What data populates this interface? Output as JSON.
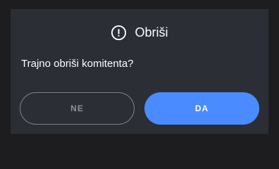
{
  "dialog": {
    "title": "Obriši",
    "title_icon": "exclamation-circle-icon",
    "message": "Trajno obriši komitenta?",
    "buttons": {
      "no_label": "NE",
      "yes_label": "DA"
    }
  },
  "colors": {
    "backdrop": "#1d1d20",
    "dialog_background": "#2c2e36",
    "text": "#ffffff",
    "secondary_button_border": "#7d7f86",
    "secondary_button_text": "#8e9097",
    "primary_button": "#4a8cff"
  }
}
